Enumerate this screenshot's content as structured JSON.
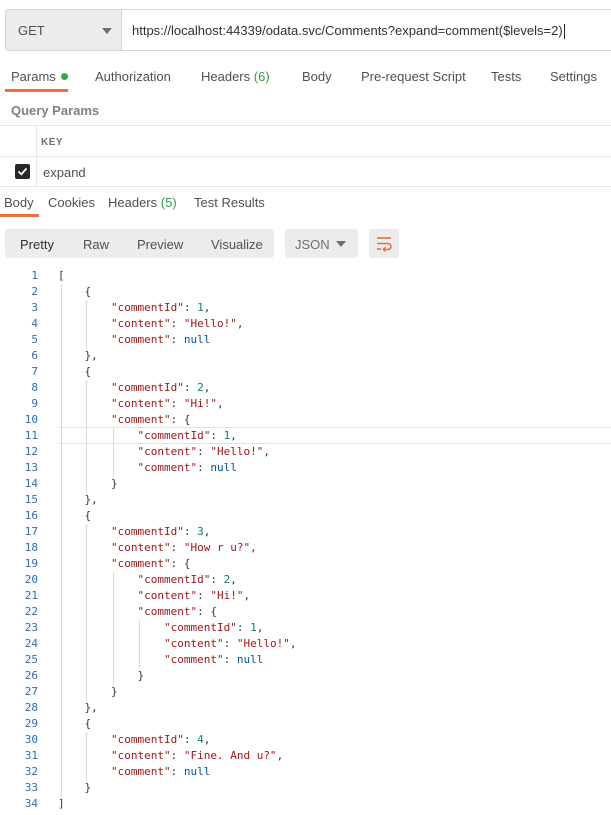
{
  "request": {
    "method": "GET",
    "url": "https://localhost:44339/odata.svc/Comments?expand=comment($levels=2)"
  },
  "request_tabs": [
    {
      "label": "Params",
      "active": true
    },
    {
      "label": "Authorization"
    },
    {
      "label": "Headers",
      "count": "(6)"
    },
    {
      "label": "Body"
    },
    {
      "label": "Pre-request Script"
    },
    {
      "label": "Tests"
    },
    {
      "label": "Settings"
    }
  ],
  "query_params": {
    "title": "Query Params",
    "key_header": "KEY",
    "rows": [
      {
        "key": "expand",
        "checked": true
      }
    ]
  },
  "response_tabs": [
    {
      "label": "Body",
      "active": true
    },
    {
      "label": "Cookies"
    },
    {
      "label": "Headers",
      "count": "(5)"
    },
    {
      "label": "Test Results"
    }
  ],
  "view_modes": [
    "Pretty",
    "Raw",
    "Preview",
    "Visualize"
  ],
  "format": "JSON",
  "colors": {
    "accent": "#f26b3a",
    "success": "#2fa84f"
  },
  "code_lines": [
    "[",
    "    {",
    "        \"commentId\": 1,",
    "        \"content\": \"Hello!\",",
    "        \"comment\": null",
    "    },",
    "    {",
    "        \"commentId\": 2,",
    "        \"content\": \"Hi!\",",
    "        \"comment\": {",
    "            \"commentId\": 1,",
    "            \"content\": \"Hello!\",",
    "            \"comment\": null",
    "        }",
    "    },",
    "    {",
    "        \"commentId\": 3,",
    "        \"content\": \"How r u?\",",
    "        \"comment\": {",
    "            \"commentId\": 2,",
    "            \"content\": \"Hi!\",",
    "            \"comment\": {",
    "                \"commentId\": 1,",
    "                \"content\": \"Hello!\",",
    "                \"comment\": null",
    "            }",
    "        }",
    "    },",
    "    {",
    "        \"commentId\": 4,",
    "        \"content\": \"Fine. And u?\",",
    "        \"comment\": null",
    "    }",
    "]"
  ]
}
